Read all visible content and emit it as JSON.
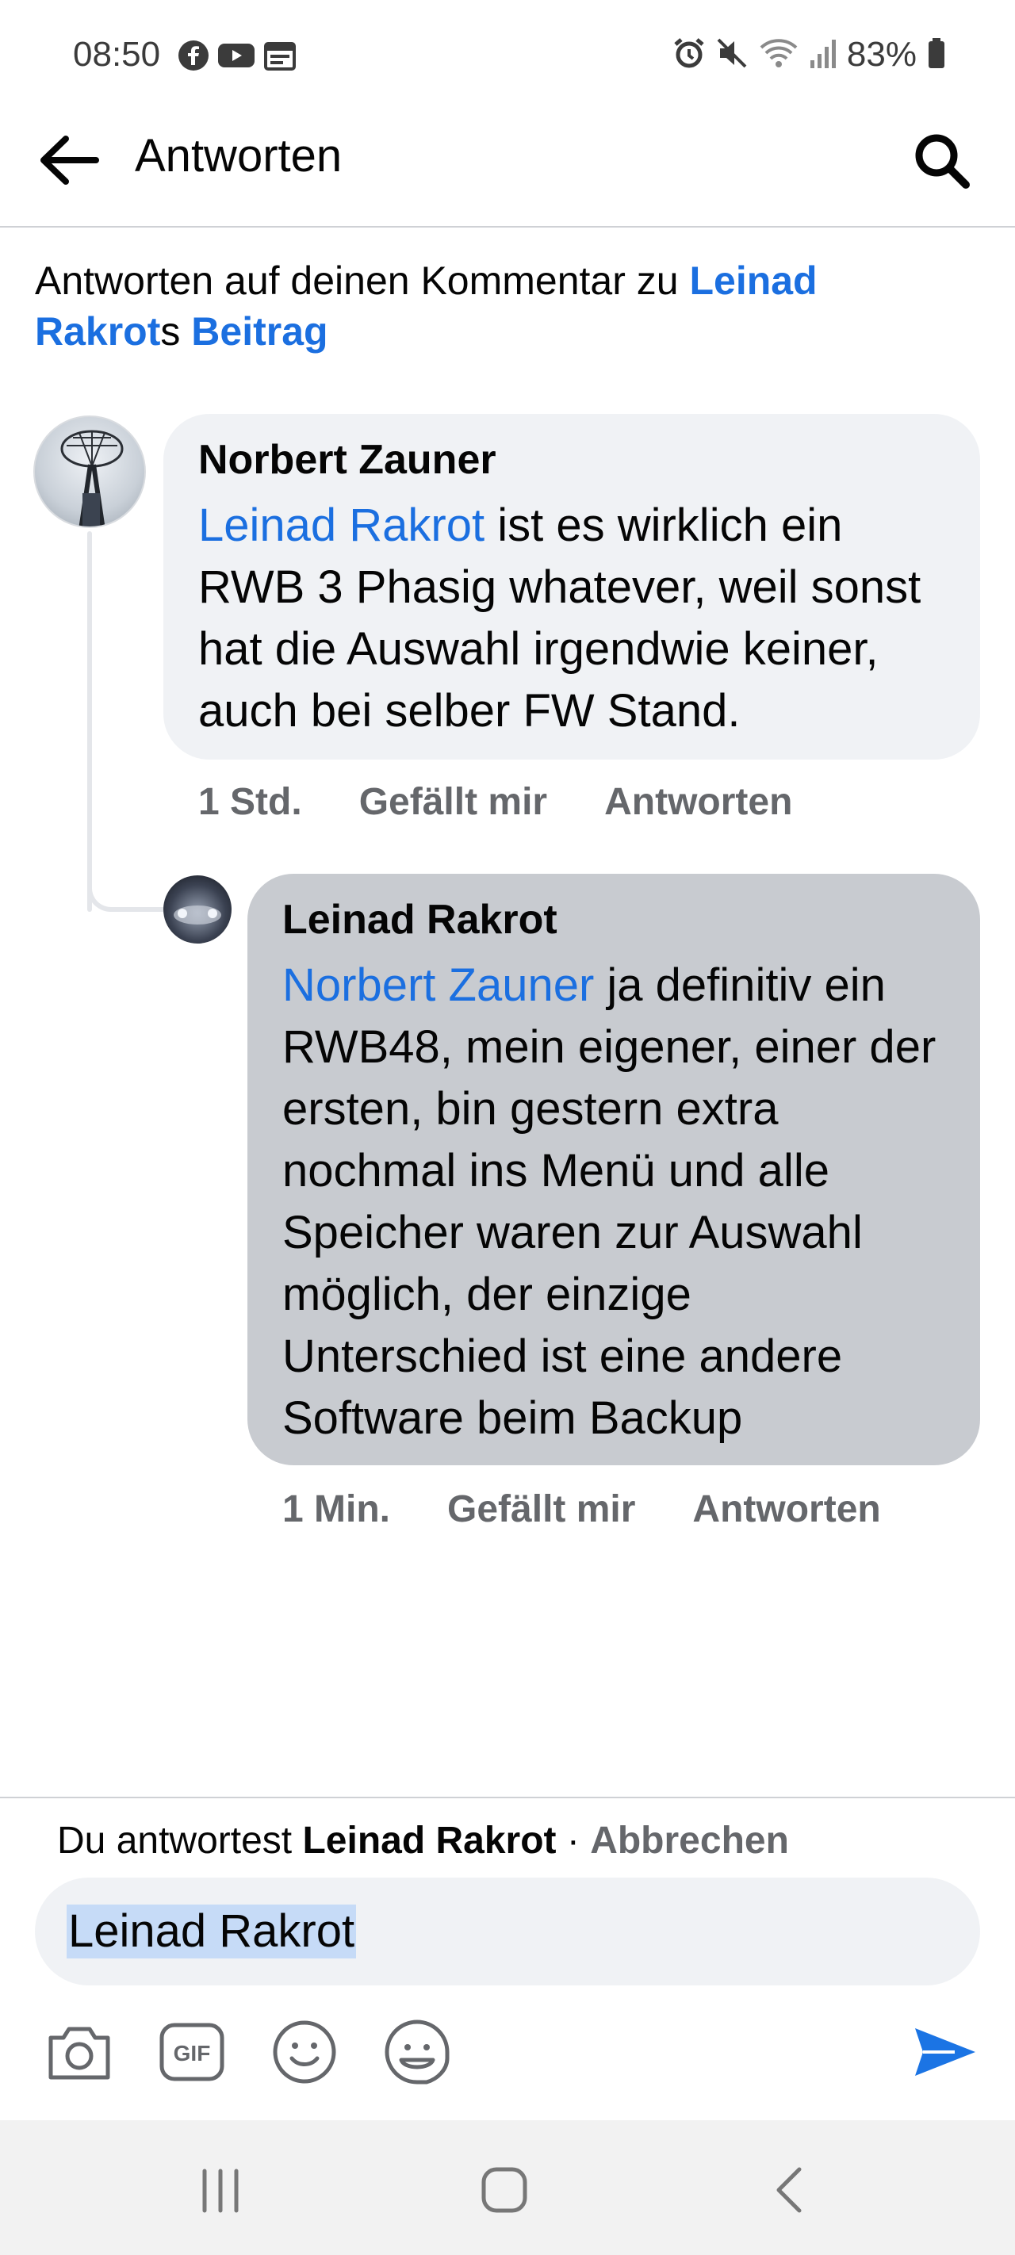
{
  "status_bar": {
    "time": "08:50",
    "battery": "83%",
    "left_icons": [
      "facebook-icon",
      "youtube-icon",
      "calendar-icon"
    ],
    "right_icons": [
      "alarm-icon",
      "mute-icon",
      "wifi-icon",
      "signal-icon",
      "battery-icon"
    ]
  },
  "header": {
    "title": "Antworten",
    "back_icon": "arrow-left-icon",
    "search_icon": "search-icon"
  },
  "context": {
    "prefix": "Antworten auf deinen Kommentar zu ",
    "author_part1": "Leinad",
    "author_part2": "Rakrot",
    "possessive": "s ",
    "post_link": "Beitrag"
  },
  "comments": [
    {
      "author": "Norbert Zauner",
      "mention": "Leinad Rakrot",
      "text": " ist es wirklich ein RWB 3 Phasig whatever, weil sonst hat die Auswahl irgendwie keiner, auch bei selber FW Stand.",
      "time": "1 Std.",
      "like_label": "Gefällt mir",
      "reply_label": "Antworten"
    },
    {
      "author": "Leinad Rakrot",
      "mention": "Norbert Zauner",
      "text": " ja definitiv ein RWB48, mein eigener, einer der ersten, bin gestern extra nochmal ins Menü und alle Speicher waren zur Auswahl möglich, der einzige Unterschied ist eine andere Software beim Backup",
      "time": "1 Min.",
      "like_label": "Gefällt mir",
      "reply_label": "Antworten"
    }
  ],
  "reply": {
    "prefix": "Du antwortest ",
    "target": "Leinad Rakrot",
    "separator": " · ",
    "cancel": "Abbrechen",
    "input_value": "Leinad Rakrot"
  },
  "toolbar_icons": [
    "camera-icon",
    "gif-icon",
    "emoji-icon",
    "sticker-icon",
    "send-icon"
  ],
  "colors": {
    "link": "#1b6fe0",
    "bubble_light": "#f0f2f5",
    "bubble_selected": "#c8cbd0",
    "meta": "#65676b"
  }
}
